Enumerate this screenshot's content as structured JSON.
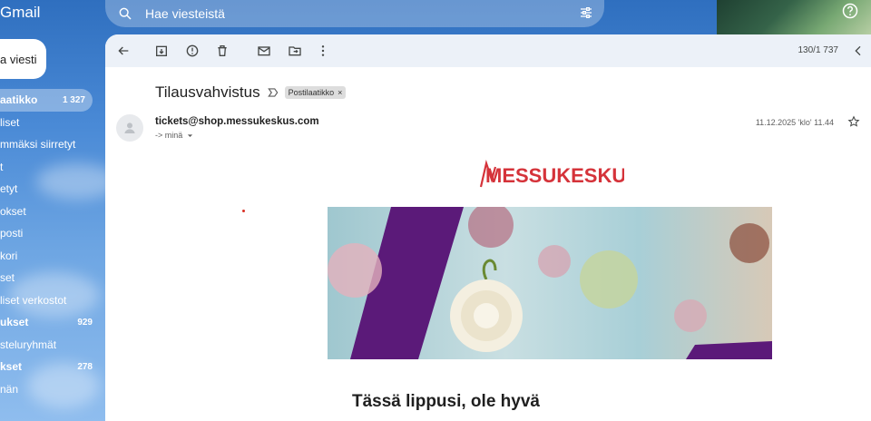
{
  "app": {
    "brand": "Gmail"
  },
  "search": {
    "placeholder": "Hae viesteistä"
  },
  "compose": {
    "label": "a viesti"
  },
  "sidebar": {
    "items": [
      {
        "label": "aatikko",
        "count": "1 327",
        "active": true
      },
      {
        "label": "liset"
      },
      {
        "label": "mmäksi siirretyt"
      },
      {
        "label": "t"
      },
      {
        "label": "etyt"
      },
      {
        "label": "okset"
      },
      {
        "label": "posti"
      },
      {
        "label": "kori"
      },
      {
        "label": "set"
      },
      {
        "label": "liset verkostot"
      },
      {
        "label": "ukset",
        "count": "929",
        "bold": true
      },
      {
        "label": "steluryhmät"
      },
      {
        "label": "kset",
        "count": "278",
        "bold": true
      },
      {
        "label": "nän"
      }
    ]
  },
  "toolbar": {
    "pager": "130/1 737"
  },
  "message": {
    "subject": "Tilausvahvistus",
    "label_chip": "Postilaatikko",
    "label_close": "×",
    "sender": "tickets@shop.messukeskus.com",
    "to": "-> minä",
    "date": "11.12.2025 'klo' 11.44",
    "logo_text": "MESSUKESKUS",
    "heading": "Tässä lippusi, ole hyvä"
  },
  "colors": {
    "brand_red": "#d5333a",
    "banner_purple": "#5b1a79"
  }
}
